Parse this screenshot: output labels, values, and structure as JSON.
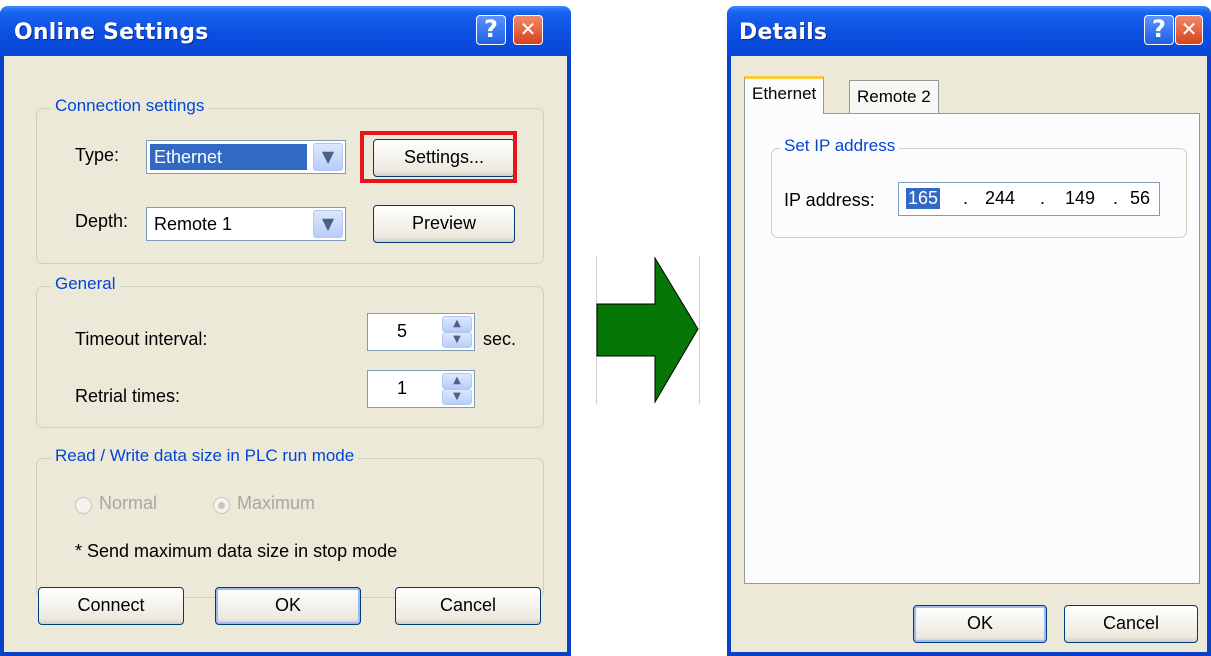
{
  "online_settings": {
    "title": "Online Settings",
    "help_glyph": "?",
    "close_glyph": "✕",
    "connection_group": "Connection settings",
    "type_label": "Type:",
    "type_value": "Ethernet",
    "settings_button": "Settings...",
    "depth_label": "Depth:",
    "depth_value": "Remote 1",
    "preview_button": "Preview",
    "general_group": "General",
    "timeout_label": "Timeout interval:",
    "timeout_value": "5",
    "timeout_unit": "sec.",
    "retrial_label": "Retrial times:",
    "retrial_value": "1",
    "rw_group": "Read / Write data size in PLC run mode",
    "radio_normal": "Normal",
    "radio_maximum": "Maximum",
    "note": "* Send maximum data size in stop mode",
    "connect_button": "Connect",
    "ok_button": "OK",
    "cancel_button": "Cancel"
  },
  "details": {
    "title": "Details",
    "help_glyph": "?",
    "close_glyph": "✕",
    "tabs": [
      "Ethernet",
      "Remote 2"
    ],
    "ip_group": "Set IP address",
    "ip_label": "IP address:",
    "ip_octets": [
      "165",
      "244",
      "149",
      "56"
    ],
    "ip_dot": ".",
    "ok_button": "OK",
    "cancel_button": "Cancel"
  },
  "colors": {
    "arrow": "#067606",
    "highlight": "#e8141c",
    "titlebar": "#0a4bd8"
  }
}
